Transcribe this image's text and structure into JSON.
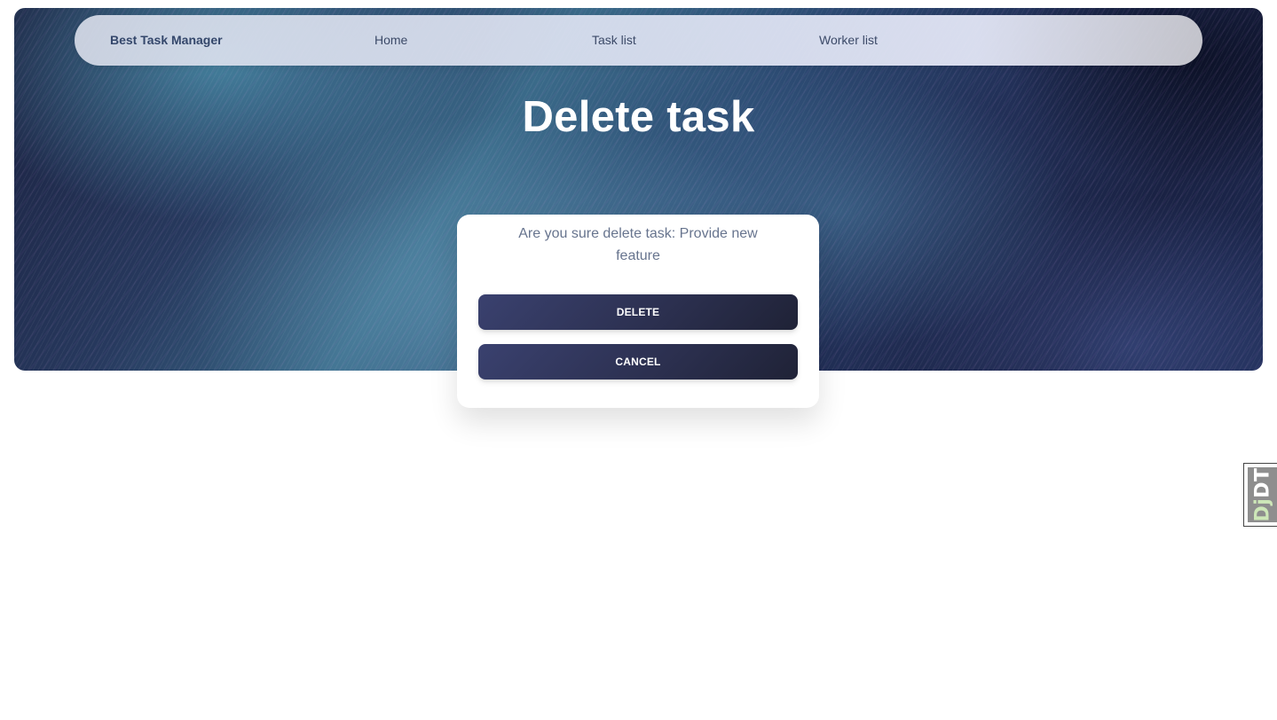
{
  "navbar": {
    "brand": "Best Task Manager",
    "links": [
      "Home",
      "Task list",
      "Worker list"
    ]
  },
  "header": {
    "title": "Delete task"
  },
  "dialog": {
    "message": "Are you sure delete task: Provide new feature",
    "delete_label": "Delete",
    "cancel_label": "Cancel"
  },
  "debug_toolbar": {
    "handle_dj": "Dj",
    "handle_dt": "DT"
  },
  "colors": {
    "brand_text": "#34476b",
    "button_gradient_start": "#3a416f",
    "button_gradient_end": "#1f2236",
    "message_text": "#67748e"
  }
}
